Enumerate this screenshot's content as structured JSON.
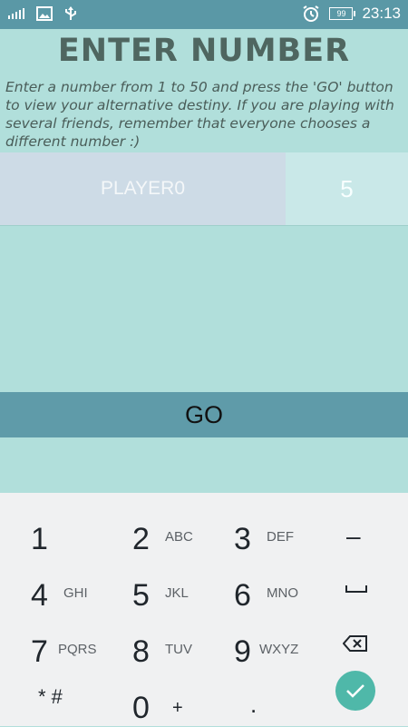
{
  "status_bar": {
    "time": "23:13",
    "battery_level": "99"
  },
  "title": "ENTER NUMBER",
  "instructions": "Enter a number from 1 to 50 and press the 'GO' button to view your alternative destiny. If you are playing with several friends, remember that everyone chooses a different number :)",
  "player": {
    "name": "PLAYER0",
    "number": "5"
  },
  "go_button": {
    "label": "GO"
  },
  "keyboard": {
    "keys": [
      {
        "digit": "1",
        "letters": ""
      },
      {
        "digit": "2",
        "letters": "ABC"
      },
      {
        "digit": "3",
        "letters": "DEF"
      },
      {
        "digit": "4",
        "letters": "GHI"
      },
      {
        "digit": "5",
        "letters": "JKL"
      },
      {
        "digit": "6",
        "letters": "MNO"
      },
      {
        "digit": "7",
        "letters": "PQRS"
      },
      {
        "digit": "8",
        "letters": "TUV"
      },
      {
        "digit": "9",
        "letters": "WXYZ"
      },
      {
        "digit": "0",
        "letters": "+"
      }
    ],
    "symbols": {
      "minus": "–",
      "star_hash": "* #",
      "dot": "."
    }
  },
  "colors": {
    "accent": "#5f9ba9",
    "background": "#b1dfdb",
    "confirm": "#4fb8a9"
  }
}
